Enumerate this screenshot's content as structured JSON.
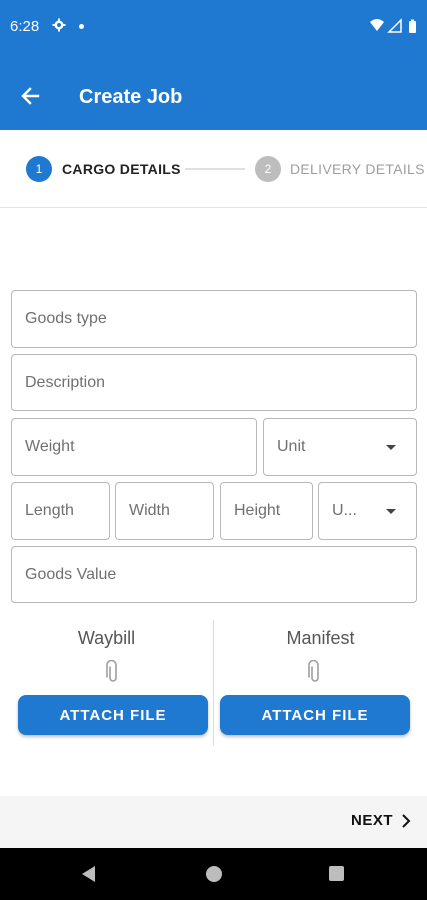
{
  "status_bar": {
    "time": "6:28",
    "icons": [
      "gear-icon",
      "notification-dot-icon",
      "wifi-icon",
      "signal-icon",
      "battery-icon"
    ]
  },
  "app_bar": {
    "title": "Create Job",
    "back_icon": "arrow-left-icon",
    "color": "#1f79d1"
  },
  "stepper": {
    "steps": [
      {
        "number": "1",
        "label": "CARGO DETAILS",
        "active": true
      },
      {
        "number": "2",
        "label": "DELIVERY DETAILS",
        "active": false
      }
    ]
  },
  "form": {
    "goods_type_placeholder": "Goods type",
    "description_placeholder": "Description",
    "weight_placeholder": "Weight",
    "weight_unit_selected": "Unit",
    "length_placeholder": "Length",
    "width_placeholder": "Width",
    "height_placeholder": "Height",
    "dimension_unit_selected": "U...",
    "goods_value_placeholder": "Goods Value"
  },
  "attachments": {
    "waybill": {
      "title": "Waybill",
      "button": "ATTACH FILE",
      "icon": "paperclip-icon"
    },
    "manifest": {
      "title": "Manifest",
      "button": "ATTACH FILE",
      "icon": "paperclip-icon"
    }
  },
  "footer": {
    "next_label": "NEXT",
    "next_icon": "chevron-right-icon"
  },
  "nav_bar": {
    "icons": [
      "nav-back-icon",
      "nav-home-icon",
      "nav-recents-icon"
    ]
  }
}
